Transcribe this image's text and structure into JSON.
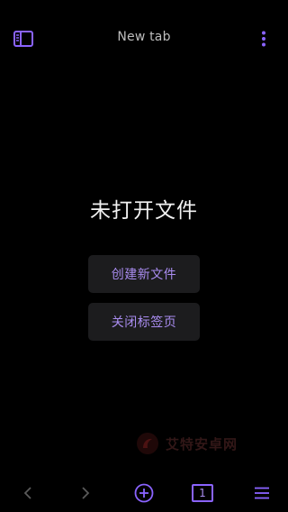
{
  "header": {
    "tab_title": "New tab"
  },
  "main": {
    "empty_message": "未打开文件",
    "create_file_label": "创建新文件",
    "close_tab_label": "关闭标签页"
  },
  "watermark": {
    "text": "艾特安卓网"
  },
  "bottom_nav": {
    "tab_count": "1"
  },
  "colors": {
    "background": "#000000",
    "accent": "#8a63ff",
    "accent_text": "#a98cf0",
    "button_bg": "#1c1c1e",
    "nav_disabled": "#5a5a5a"
  },
  "icons": {
    "sidebar": "sidebar-icon",
    "more": "more-vertical-icon",
    "back": "chevron-left-icon",
    "forward": "chevron-right-icon",
    "new_tab": "plus-circle-icon",
    "menu": "hamburger-menu-icon"
  }
}
